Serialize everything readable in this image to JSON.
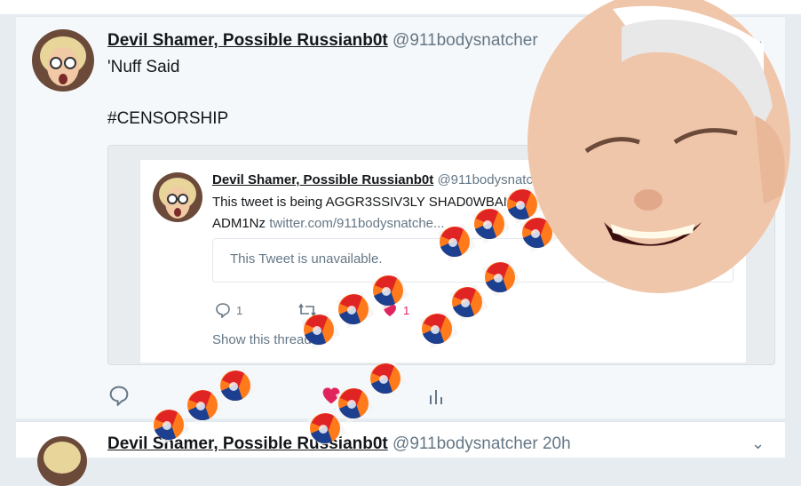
{
  "tweet": {
    "name": "Devil Shamer, Possible Russianb0t",
    "handle": "@911bodysnatcher",
    "line1": "'Nuff Said",
    "line2": "#CENSORSHIP"
  },
  "quoted": {
    "name": "Devil Shamer, Possible Russianb0t",
    "handle": "@911bodysnatcher",
    "text_line1": "This tweet is being AGGR3SSIV3LY SHAD0WBANN...",
    "text_line2_prefix": "ADM1Nz",
    "text_line2_link": "twitter.com/911bodysnatche...",
    "unavailable": "This Tweet is unavailable.",
    "reply_count": "1",
    "like_count": "1",
    "show_thread": "Show this thread"
  },
  "next_tweet": {
    "name": "Devil Shamer, Possible Russianb0t",
    "handle": "@911bodysnatcher",
    "time": "20h"
  },
  "colors": {
    "like": "#e0245e",
    "text": "#14171a",
    "muted": "#657786"
  }
}
